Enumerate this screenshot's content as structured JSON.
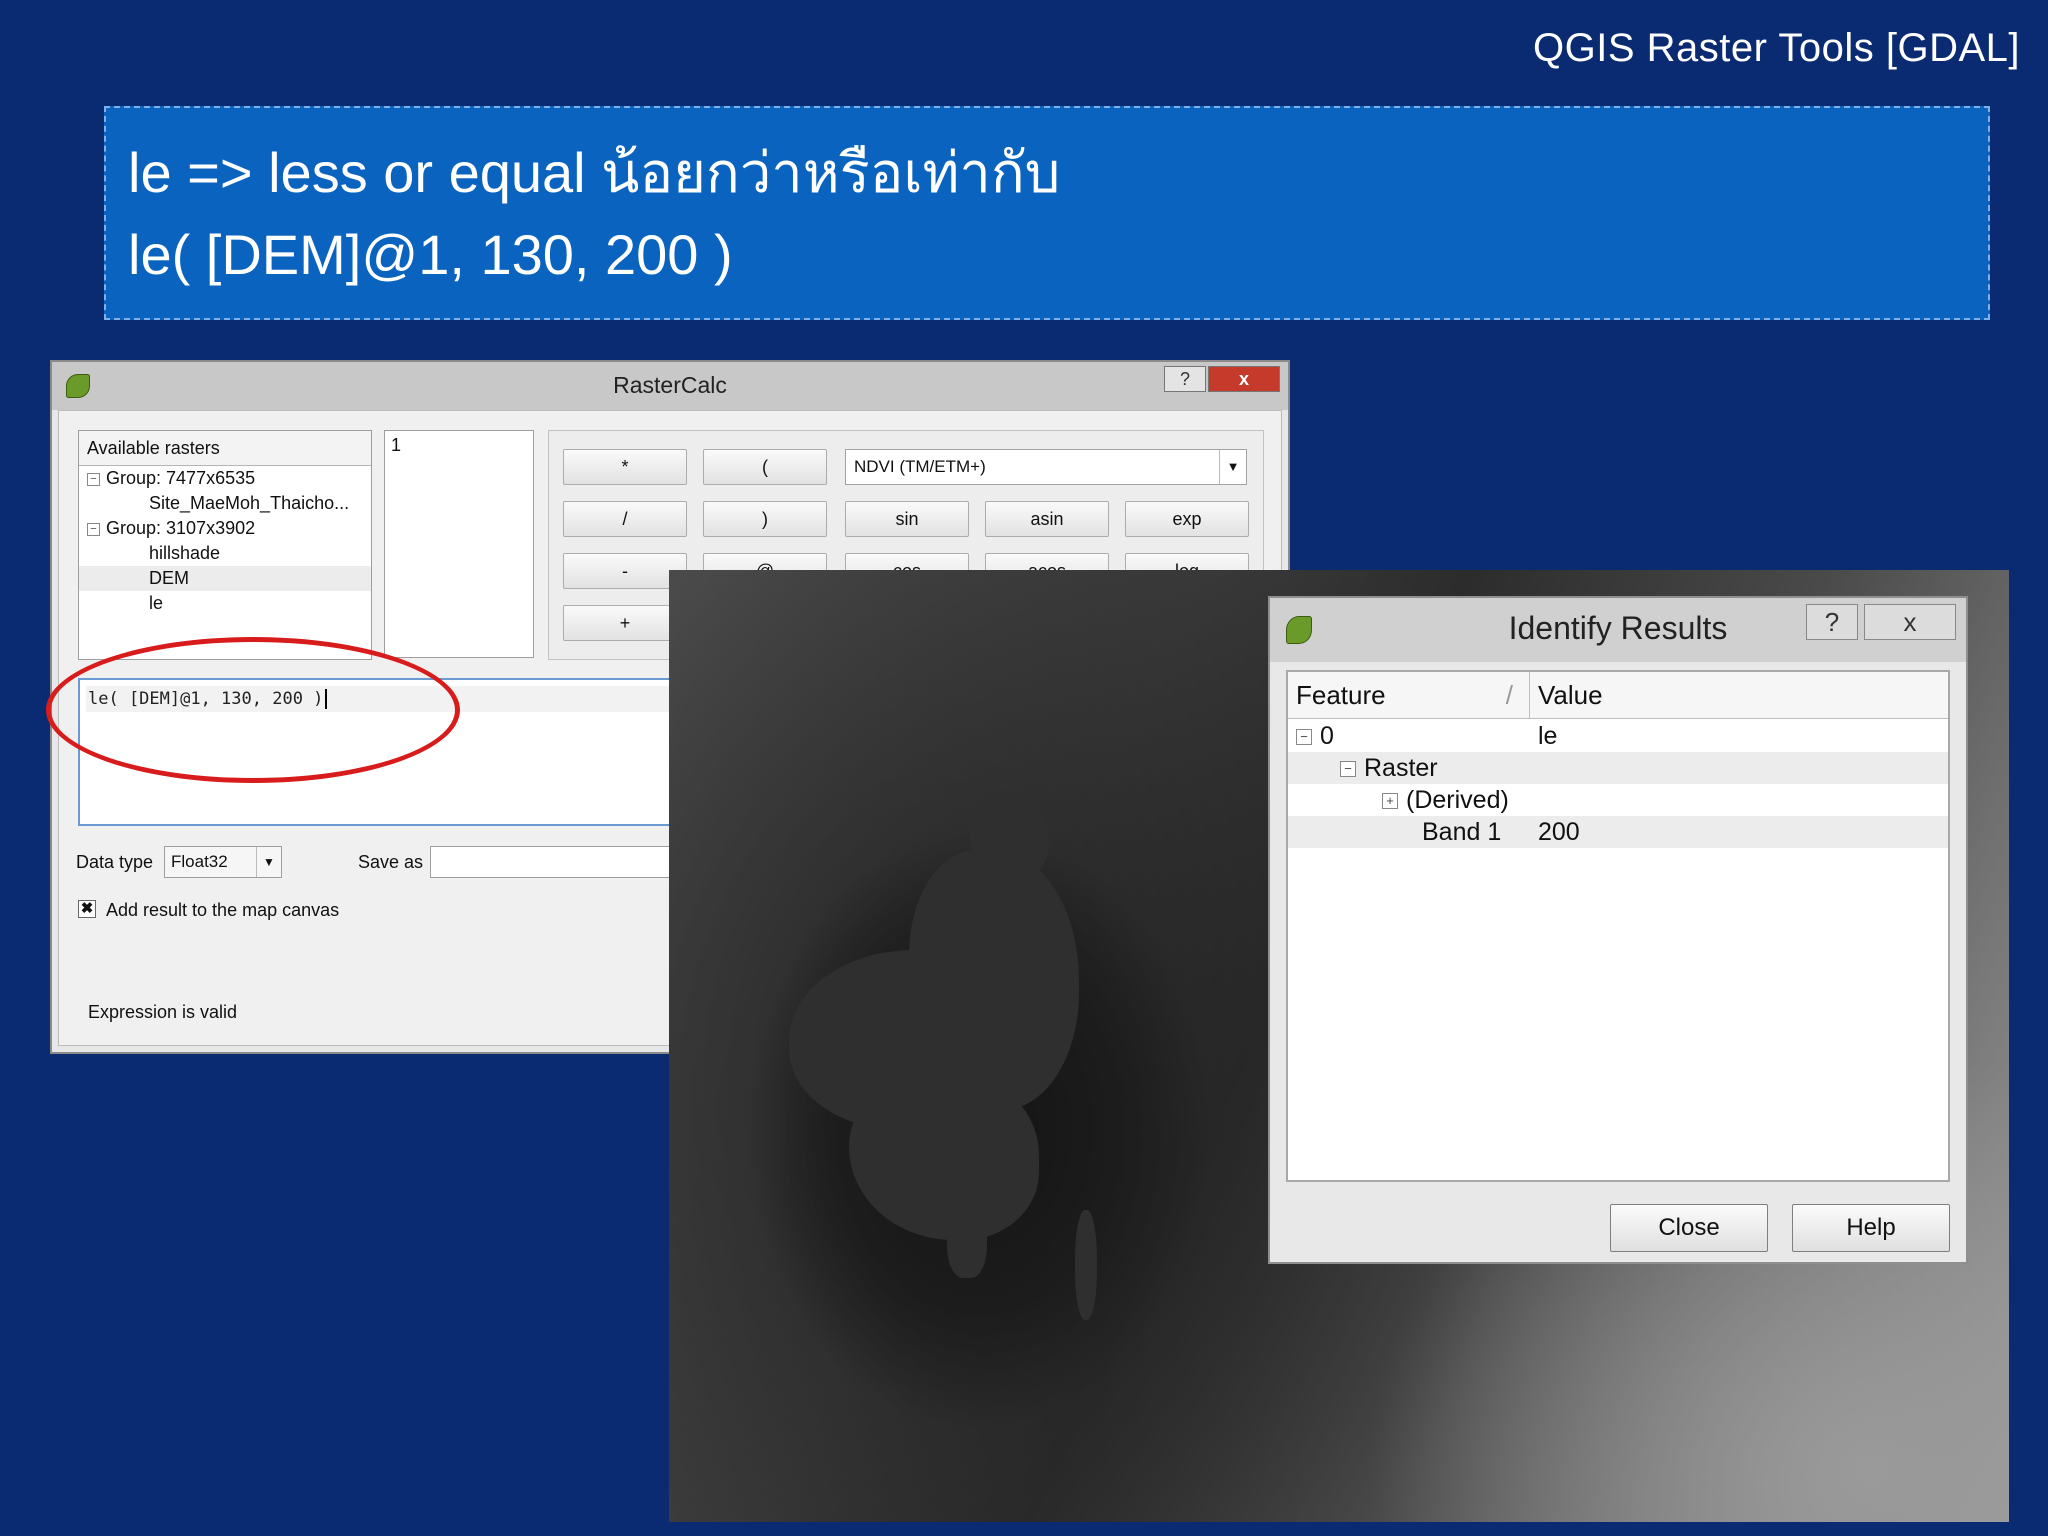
{
  "header": {
    "title": "QGIS Raster Tools [GDAL]"
  },
  "banner": {
    "line1": "le => less or equal น้อยกว่าหรือเท่ากับ",
    "line2": "le( [DEM]@1, 130, 200 )"
  },
  "rastercalc": {
    "title": "RasterCalc",
    "help_btn": "?",
    "close_btn": "x",
    "available_header": "Available rasters",
    "tree": [
      {
        "label": "Group: 7477x6535"
      },
      {
        "label": "Site_MaeMoh_Thaicho..."
      },
      {
        "label": "Group: 3107x3902"
      },
      {
        "label": "hillshade"
      },
      {
        "label": "DEM"
      },
      {
        "label": "le"
      }
    ],
    "band_list": [
      "1"
    ],
    "operators": {
      "mul": "*",
      "lparen": "(",
      "div": "/",
      "rparen": ")",
      "sin": "sin",
      "asin": "asin",
      "exp": "exp",
      "minus": "-",
      "at": "@",
      "cos": "cos",
      "acos": "acos",
      "log": "log",
      "plus": "+"
    },
    "preset_combo": "NDVI (TM/ETM+)",
    "expression": "le( [DEM]@1, 130, 200 )",
    "data_type_label": "Data type",
    "data_type_value": "Float32",
    "save_as_label": "Save as",
    "add_result_label": "Add result to the map canvas",
    "add_result_checked": true,
    "status": "Expression is valid"
  },
  "identify": {
    "title": "Identify Results",
    "help_btn": "?",
    "close_btn": "x",
    "col_feature": "Feature",
    "col_value": "Value",
    "rows": [
      {
        "feature": "0",
        "value": "le"
      },
      {
        "feature": "Raster",
        "value": ""
      },
      {
        "feature": "(Derived)",
        "value": ""
      },
      {
        "feature": "Band 1",
        "value": "200"
      }
    ],
    "close_label": "Close",
    "help_label": "Help"
  },
  "colors": {
    "background": "#0a2a72",
    "banner": "#0a63bf",
    "highlight_ellipse": "#d81c1c"
  }
}
